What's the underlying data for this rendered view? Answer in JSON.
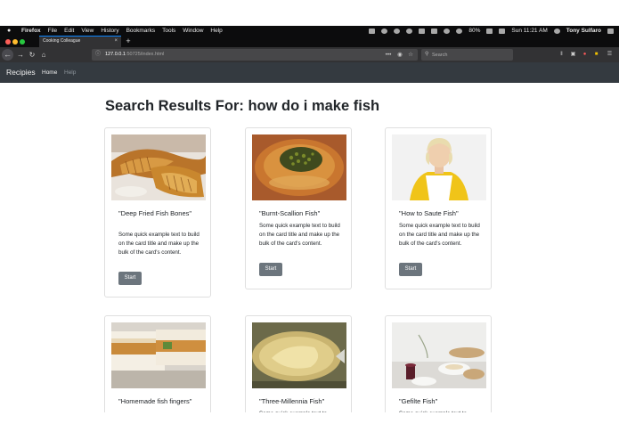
{
  "menubar": {
    "app": "Firefox",
    "items": [
      "File",
      "Edit",
      "View",
      "History",
      "Bookmarks",
      "Tools",
      "Window",
      "Help"
    ],
    "battery": "80%",
    "clock": "Sun 11:21 AM",
    "user": "Tony Sulfaro"
  },
  "tab": {
    "title": "Cooking Colleague",
    "close": "×",
    "new": "+"
  },
  "urlbar": {
    "host": "127.0.0.1",
    "path": ":50725/index.html",
    "more": "•••",
    "search_placeholder": "Search"
  },
  "site": {
    "brand": "Recipies",
    "nav": {
      "home": "Home",
      "help": "Help"
    }
  },
  "page": {
    "heading": "Search Results For: how do i make fish",
    "cards": [
      {
        "title": "\"Deep Fried Fish Bones\"",
        "text": "Some quick example text to build on the card title and make up the bulk of the card's content.",
        "button": "Start"
      },
      {
        "title": "\"Burnt-Scallion Fish\"",
        "text": "Some quick example text to build on the card title and make up the bulk of the card's content.",
        "button": "Start"
      },
      {
        "title": "\"How to Saute Fish\"",
        "text": "Some quick example text to build on the card title and make up the bulk of the card's content.",
        "button": "Start"
      },
      {
        "title": "\"Homemade fish fingers\"",
        "text": "",
        "button": ""
      },
      {
        "title": "\"Three-Millennia Fish\"",
        "text": "Some quick example text to",
        "button": ""
      },
      {
        "title": "\"Gefilte Fish\"",
        "text": "Some quick example text to",
        "button": ""
      }
    ]
  }
}
